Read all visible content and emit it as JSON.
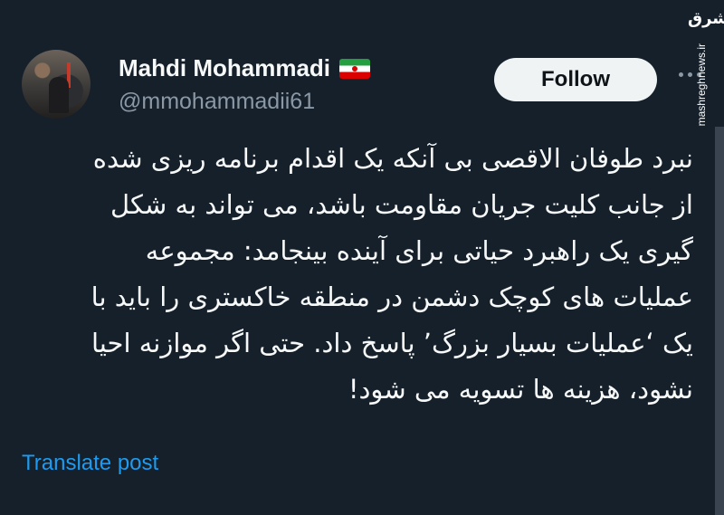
{
  "author": {
    "display_name": "Mahdi Mohammadi",
    "handle": "@mmohammadii61",
    "badge_icon": "iran-flag-icon"
  },
  "actions": {
    "follow_label": "Follow",
    "more_icon": "more-options-icon"
  },
  "tweet": {
    "lines": [
      "نبرد طوفان الاقصی بی آنکه یک اقدام برنامه ریزی شده",
      "از جانب کلیت جریان مقاومت باشد، می تواند به شکل",
      "گیری یک راهبرد حیاتی برای آینده بینجامد: مجموعه",
      "عملیات های کوچک دشمن در منطقه خاکستری را باید با",
      "یک ‘عملیات بسیار بزرگ’ پاسخ داد. حتی اگر موازنه احیا",
      "نشود، هزینه ها تسویه می شود!"
    ],
    "translate_label": "Translate post"
  },
  "watermark": {
    "logo_text": "مشرق",
    "url": "mashreghnews.ir"
  },
  "colors": {
    "background": "#15202b",
    "link": "#1d9bf0",
    "secondary_text": "#8b98a5"
  }
}
